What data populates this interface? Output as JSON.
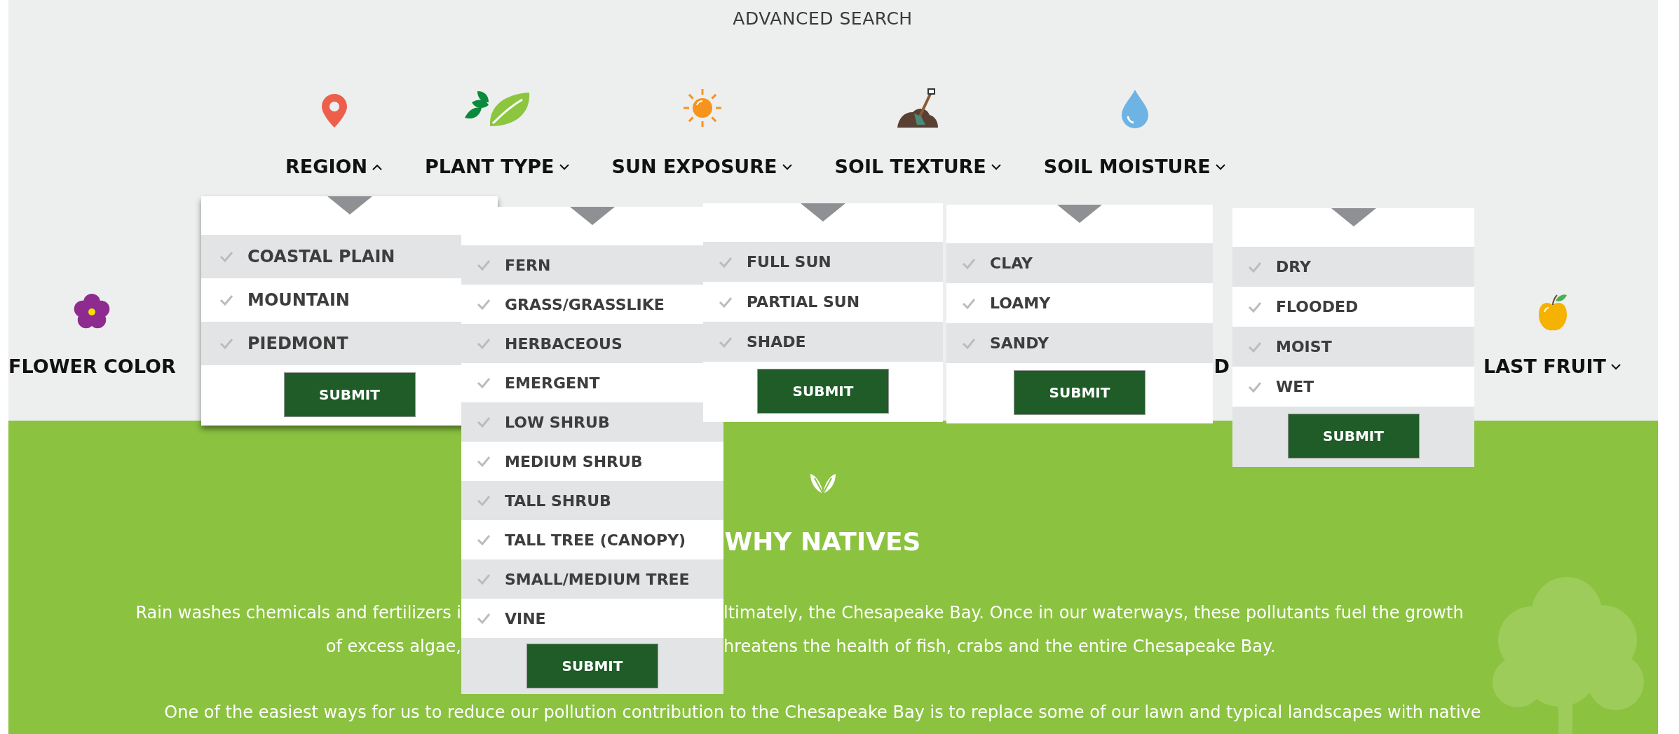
{
  "title": "ADVANCED SEARCH",
  "filters": [
    {
      "label": "REGION",
      "kind": "pin",
      "expanded": true,
      "submit": "SUBMIT",
      "options": [
        {
          "label": "COASTAL PLAIN",
          "checked": false
        },
        {
          "label": "MOUNTAIN",
          "checked": false
        },
        {
          "label": "PIEDMONT",
          "checked": false
        }
      ]
    },
    {
      "label": "PLANT TYPE",
      "kind": "leaves",
      "expanded": false,
      "submit": "SUBMIT",
      "options": [
        {
          "label": "FERN",
          "checked": false
        },
        {
          "label": "GRASS/GRASSLIKE",
          "checked": false
        },
        {
          "label": "HERBACEOUS",
          "checked": false
        },
        {
          "label": "EMERGENT",
          "checked": false
        },
        {
          "label": "LOW SHRUB",
          "checked": false
        },
        {
          "label": "MEDIUM SHRUB",
          "checked": false
        },
        {
          "label": "TALL SHRUB",
          "checked": false
        },
        {
          "label": "TALL TREE (CANOPY)",
          "checked": false
        },
        {
          "label": "SMALL/MEDIUM TREE",
          "checked": false
        },
        {
          "label": "VINE",
          "checked": false
        }
      ]
    },
    {
      "label": "SUN EXPOSURE",
      "kind": "sun",
      "expanded": false,
      "submit": "SUBMIT",
      "options": [
        {
          "label": "FULL SUN",
          "checked": false
        },
        {
          "label": "PARTIAL SUN",
          "checked": false
        },
        {
          "label": "SHADE",
          "checked": false
        }
      ]
    },
    {
      "label": "SOIL TEXTURE",
      "kind": "soil",
      "expanded": false,
      "submit": "SUBMIT",
      "options": [
        {
          "label": "CLAY",
          "checked": false
        },
        {
          "label": "LOAMY",
          "checked": false
        },
        {
          "label": "SANDY",
          "checked": false
        }
      ]
    },
    {
      "label": "SOIL MOISTURE",
      "kind": "drop",
      "expanded": false,
      "submit": "SUBMIT",
      "options": [
        {
          "label": "DRY",
          "checked": false
        },
        {
          "label": "FLOODED",
          "checked": false
        },
        {
          "label": "MOIST",
          "checked": false
        },
        {
          "label": "WET",
          "checked": false
        }
      ]
    }
  ],
  "more_filters": [
    {
      "label": "FLOWER COLOR",
      "kind": "flower"
    },
    {
      "label": "D",
      "kind": "cut"
    },
    {
      "label": "LAST FRUIT",
      "kind": "apple",
      "expanded": false
    }
  ],
  "why_natives": {
    "heading": "WHY NATIVES",
    "lines": [
      {
        "left": "Rain washes chemicals and fertilizers i",
        "right": "ltimately, the Chesapeake Bay. Once in our waterways, these pollutants fuel the growth"
      },
      {
        "left": "of excess algae,",
        "right": "hreatens the health of fish, crabs and the entire Chesapeake Bay."
      },
      {
        "text": "One of the easiest ways for us to reduce our pollution contribution to the Chesapeake Bay is to replace some of our lawn and typical landscapes with native"
      }
    ]
  }
}
